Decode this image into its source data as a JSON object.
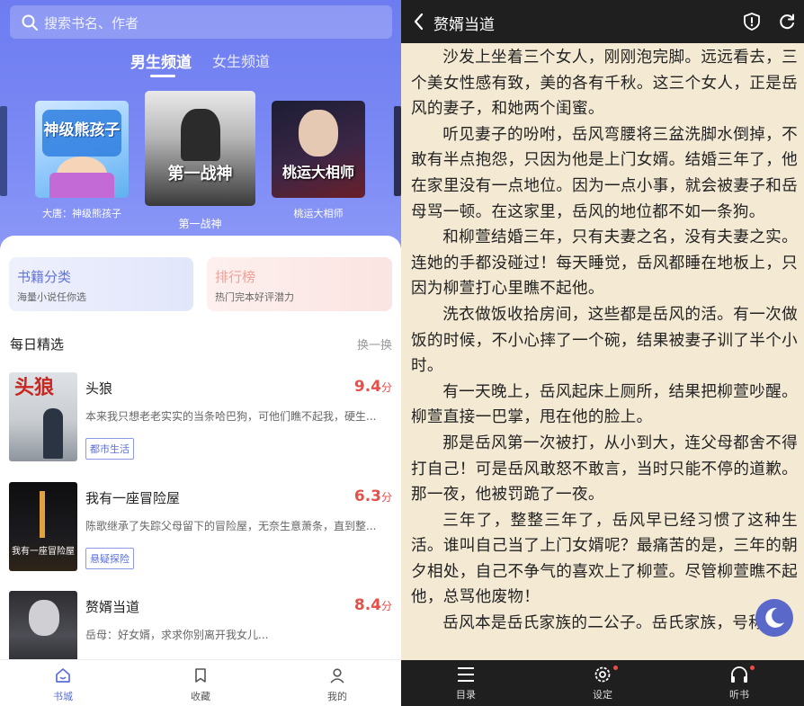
{
  "left": {
    "search": {
      "placeholder": "搜索书名、作者"
    },
    "channels": [
      {
        "label": "男生频道",
        "active": true
      },
      {
        "label": "女生频道",
        "active": false
      }
    ],
    "carousel": [
      {
        "caption": "大唐：神级熊孩子",
        "cover_text": "神级熊孩子"
      },
      {
        "caption": "第一战神",
        "cover_text": "第一战神"
      },
      {
        "caption": "桃运大相师",
        "cover_text": "桃运大相师"
      }
    ],
    "cards": [
      {
        "title": "书籍分类",
        "subtitle": "海量小说任你选",
        "color": "#6274d6"
      },
      {
        "title": "排行榜",
        "subtitle": "热门完本好评潜力",
        "color": "#f0a098"
      }
    ],
    "section": {
      "title": "每日精选",
      "more": "换一换"
    },
    "books": [
      {
        "title": "头狼",
        "score": "9.4",
        "unit": "分",
        "desc": "本来我只想老老实实的当条哈巴狗，可他们瞧不起我，硬生...",
        "tag": "都市生活",
        "cover_text": "头狼"
      },
      {
        "title": "我有一座冒险屋",
        "score": "6.3",
        "unit": "分",
        "desc": "陈歌继承了失踪父母留下的冒险屋，无奈生意萧条，直到整...",
        "tag": "悬疑探险",
        "cover_text": "我有一座冒险屋"
      },
      {
        "title": "赘婿当道",
        "score": "8.4",
        "unit": "分",
        "desc": "岳母：好女婿，求求你别离开我女儿...",
        "tag": "",
        "cover_text": ""
      }
    ],
    "tabbar": [
      {
        "label": "书城",
        "icon": "home-icon",
        "active": true
      },
      {
        "label": "收藏",
        "icon": "bookmark-icon",
        "active": false
      },
      {
        "label": "我的",
        "icon": "user-icon",
        "active": false
      }
    ]
  },
  "right": {
    "title": "赘婿当道",
    "paragraphs": [
      "沙发上坐着三个女人，刚刚泡完脚。远远看去，三个美女性感有致，美的各有千秋。这三个女人，正是岳风的妻子，和她两个闺蜜。",
      "听见妻子的吩咐，岳风弯腰将三盆洗脚水倒掉，不敢有半点抱怨，只因为他是上门女婿。结婚三年了，他在家里没有一点地位。因为一点小事，就会被妻子和岳母骂一顿。在这家里，岳风的地位都不如一条狗。",
      "和柳萱结婚三年，只有夫妻之名，没有夫妻之实。连她的手都没碰过！每天睡觉，岳风都睡在地板上，只因为柳萱打心里瞧不起他。",
      "洗衣做饭收拾房间，这些都是岳风的活。有一次做饭的时候，不小心摔了一个碗，结果被妻子训了半个小时。",
      "有一天晚上，岳风起床上厕所，结果把柳萱吵醒。柳萱直接一巴掌，甩在他的脸上。",
      "那是岳风第一次被打，从小到大，连父母都舍不得打自己！可是岳风敢怒不敢言，当时只能不停的道歉。那一夜，他被罚跪了一夜。",
      "三年了，整整三年了，岳风早已经习惯了这种生活。谁叫自己当了上门女婿呢？最痛苦的是，三年的朝夕相处，自己不争气的喜欢上了柳萱。尽管柳萱瞧不起他，总骂他废物！",
      "岳风本是岳氏家族的二公子。岳氏家族，号称"
    ],
    "bottom": [
      {
        "label": "目录",
        "icon": "menu-icon"
      },
      {
        "label": "设定",
        "icon": "settings-icon"
      },
      {
        "label": "听书",
        "icon": "headphones-icon"
      }
    ]
  }
}
